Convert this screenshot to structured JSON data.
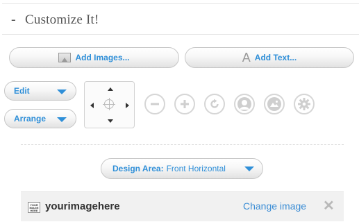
{
  "header": {
    "collapse_symbol": "-",
    "title": "Customize It!"
  },
  "toolbar": {
    "add_images_label": "Add Images...",
    "add_text_label": "Add Text...",
    "edit_label": "Edit",
    "arrange_label": "Arrange",
    "icons": {
      "add_images": "image-icon",
      "add_text": "text-icon",
      "tools": [
        "minus-circle-icon",
        "plus-circle-icon",
        "rotate-icon",
        "user-silhouette-icon",
        "landscape-icon",
        "gear-icon"
      ]
    }
  },
  "design_area": {
    "label": "Design Area:",
    "value": "Front Horizontal"
  },
  "image_item": {
    "thumbnail_text": "YOUR IMAGE HERE",
    "filename": "yourimagehere",
    "change_label": "Change image",
    "remove_symbol": "✕"
  },
  "colors": {
    "accent": "#2f8fd8",
    "icon_gray": "#cfcfcf"
  }
}
